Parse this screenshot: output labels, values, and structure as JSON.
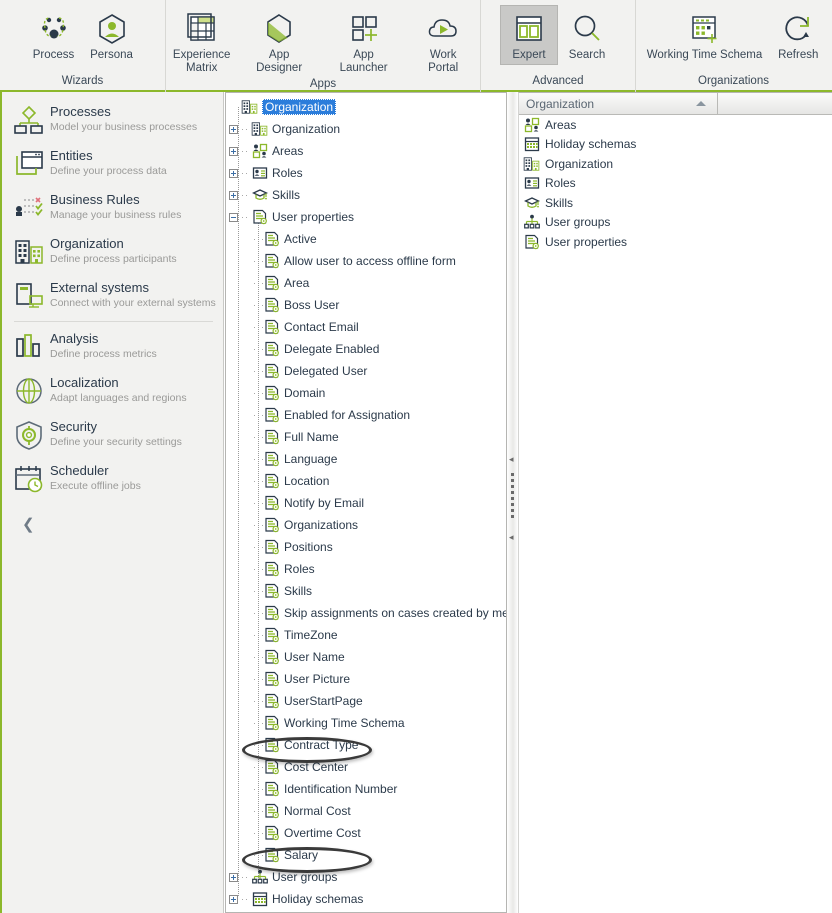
{
  "ribbon": {
    "groups": [
      {
        "title": "Wizards",
        "buttons": [
          {
            "label": "Process",
            "icon": "process-wizard-icon",
            "active": false
          },
          {
            "label": "Persona",
            "icon": "persona-icon",
            "active": false
          }
        ]
      },
      {
        "title": "Apps",
        "buttons": [
          {
            "label": "Experience\nMatrix",
            "icon": "experience-matrix-icon",
            "active": false
          },
          {
            "label": "App Designer",
            "icon": "app-designer-icon",
            "active": false
          },
          {
            "label": "App Launcher",
            "icon": "app-launcher-icon",
            "active": false
          },
          {
            "label": "Work Portal",
            "icon": "work-portal-icon",
            "active": false
          }
        ]
      },
      {
        "title": "Advanced",
        "buttons": [
          {
            "label": "Expert",
            "icon": "expert-icon",
            "active": true
          },
          {
            "label": "Search",
            "icon": "search-icon",
            "active": false
          }
        ]
      },
      {
        "title": "Organizations",
        "buttons": [
          {
            "label": "Working Time Schema",
            "icon": "working-time-schema-icon",
            "active": false
          },
          {
            "label": "Refresh",
            "icon": "refresh-icon",
            "active": false
          }
        ]
      }
    ]
  },
  "sidebar": {
    "items": [
      {
        "title": "Processes",
        "subtitle": "Model your business processes",
        "icon": "processes-icon"
      },
      {
        "title": "Entities",
        "subtitle": "Define your process data",
        "icon": "entities-icon"
      },
      {
        "title": "Business Rules",
        "subtitle": "Manage your business rules",
        "icon": "business-rules-icon"
      },
      {
        "title": "Organization",
        "subtitle": "Define process participants",
        "icon": "organization-icon"
      },
      {
        "title": "External systems",
        "subtitle": "Connect with your external systems",
        "icon": "external-systems-icon"
      },
      {
        "title": "Analysis",
        "subtitle": "Define process metrics",
        "icon": "analysis-icon"
      },
      {
        "title": "Localization",
        "subtitle": "Adapt languages and regions",
        "icon": "localization-icon"
      },
      {
        "title": "Security",
        "subtitle": "Define your security settings",
        "icon": "security-icon"
      },
      {
        "title": "Scheduler",
        "subtitle": "Execute offline jobs",
        "icon": "scheduler-icon"
      }
    ],
    "collapse_icon": "chevron-left-icon"
  },
  "tree": {
    "nodes": [
      {
        "label": "Organization",
        "icon": "organization-icon",
        "depth": 0,
        "twist": "none",
        "selected": true
      },
      {
        "label": "Organization",
        "icon": "organization-icon",
        "depth": 1,
        "twist": "plus",
        "selected": false
      },
      {
        "label": "Areas",
        "icon": "areas-icon",
        "depth": 1,
        "twist": "plus",
        "selected": false
      },
      {
        "label": "Roles",
        "icon": "roles-icon",
        "depth": 1,
        "twist": "plus",
        "selected": false
      },
      {
        "label": "Skills",
        "icon": "skills-icon",
        "depth": 1,
        "twist": "plus",
        "selected": false
      },
      {
        "label": "User properties",
        "icon": "property-icon",
        "depth": 1,
        "twist": "minus",
        "selected": false
      },
      {
        "label": "Active",
        "icon": "property-icon",
        "depth": 2,
        "twist": "none",
        "selected": false
      },
      {
        "label": "Allow user to access offline form",
        "icon": "property-icon",
        "depth": 2,
        "twist": "none",
        "selected": false
      },
      {
        "label": "Area",
        "icon": "property-icon",
        "depth": 2,
        "twist": "none",
        "selected": false
      },
      {
        "label": "Boss User",
        "icon": "property-icon",
        "depth": 2,
        "twist": "none",
        "selected": false
      },
      {
        "label": "Contact Email",
        "icon": "property-icon",
        "depth": 2,
        "twist": "none",
        "selected": false
      },
      {
        "label": "Delegate Enabled",
        "icon": "property-icon",
        "depth": 2,
        "twist": "none",
        "selected": false
      },
      {
        "label": "Delegated User",
        "icon": "property-icon",
        "depth": 2,
        "twist": "none",
        "selected": false
      },
      {
        "label": "Domain",
        "icon": "property-icon",
        "depth": 2,
        "twist": "none",
        "selected": false
      },
      {
        "label": "Enabled for Assignation",
        "icon": "property-icon",
        "depth": 2,
        "twist": "none",
        "selected": false
      },
      {
        "label": "Full Name",
        "icon": "property-icon",
        "depth": 2,
        "twist": "none",
        "selected": false
      },
      {
        "label": "Language",
        "icon": "property-icon",
        "depth": 2,
        "twist": "none",
        "selected": false
      },
      {
        "label": "Location",
        "icon": "property-icon",
        "depth": 2,
        "twist": "none",
        "selected": false
      },
      {
        "label": "Notify by Email",
        "icon": "property-icon",
        "depth": 2,
        "twist": "none",
        "selected": false
      },
      {
        "label": "Organizations",
        "icon": "property-icon",
        "depth": 2,
        "twist": "none",
        "selected": false
      },
      {
        "label": "Positions",
        "icon": "property-icon",
        "depth": 2,
        "twist": "none",
        "selected": false
      },
      {
        "label": "Roles",
        "icon": "property-icon",
        "depth": 2,
        "twist": "none",
        "selected": false
      },
      {
        "label": "Skills",
        "icon": "property-icon",
        "depth": 2,
        "twist": "none",
        "selected": false
      },
      {
        "label": "Skip assignments on cases created by me",
        "icon": "property-icon",
        "depth": 2,
        "twist": "none",
        "selected": false
      },
      {
        "label": "TimeZone",
        "icon": "property-icon",
        "depth": 2,
        "twist": "none",
        "selected": false
      },
      {
        "label": "User Name",
        "icon": "property-icon",
        "depth": 2,
        "twist": "none",
        "selected": false
      },
      {
        "label": "User Picture",
        "icon": "property-icon",
        "depth": 2,
        "twist": "none",
        "selected": false
      },
      {
        "label": "UserStartPage",
        "icon": "property-icon",
        "depth": 2,
        "twist": "none",
        "selected": false
      },
      {
        "label": "Working Time Schema",
        "icon": "property-icon",
        "depth": 2,
        "twist": "none",
        "selected": false
      },
      {
        "label": "Contract Type",
        "icon": "property-icon",
        "depth": 2,
        "twist": "none",
        "selected": false,
        "highlighted": true
      },
      {
        "label": "Cost Center",
        "icon": "property-icon",
        "depth": 2,
        "twist": "none",
        "selected": false
      },
      {
        "label": "Identification Number",
        "icon": "property-icon",
        "depth": 2,
        "twist": "none",
        "selected": false
      },
      {
        "label": "Normal Cost",
        "icon": "property-icon",
        "depth": 2,
        "twist": "none",
        "selected": false
      },
      {
        "label": "Overtime Cost",
        "icon": "property-icon",
        "depth": 2,
        "twist": "none",
        "selected": false
      },
      {
        "label": "Salary",
        "icon": "property-icon",
        "depth": 2,
        "twist": "none",
        "selected": false,
        "highlighted": true
      },
      {
        "label": "User groups",
        "icon": "user-groups-icon",
        "depth": 1,
        "twist": "plus",
        "selected": false
      },
      {
        "label": "Holiday schemas",
        "icon": "holiday-schemas-icon",
        "depth": 1,
        "twist": "plus",
        "selected": false
      }
    ]
  },
  "rightpanel": {
    "column_header": "Organization",
    "sort_indicator": "sort-ascending-icon",
    "rows": [
      {
        "label": "Areas",
        "icon": "areas-icon"
      },
      {
        "label": "Holiday schemas",
        "icon": "holiday-schemas-icon"
      },
      {
        "label": "Organization",
        "icon": "organization-icon"
      },
      {
        "label": "Roles",
        "icon": "roles-icon"
      },
      {
        "label": "Skills",
        "icon": "skills-icon"
      },
      {
        "label": "User groups",
        "icon": "user-groups-icon"
      },
      {
        "label": "User properties",
        "icon": "property-icon"
      }
    ]
  },
  "splitter": {
    "collapse_left_icon": "triangle-left-icon",
    "grip_icon": "grip-dots-icon"
  },
  "colors": {
    "accent_green": "#8cb82b",
    "dark_slate": "#2b3a4a",
    "selection_blue": "#2b7ddb",
    "ribbon_bg": "#f2f2f0",
    "highlight_oval": "#3a3a3a"
  }
}
